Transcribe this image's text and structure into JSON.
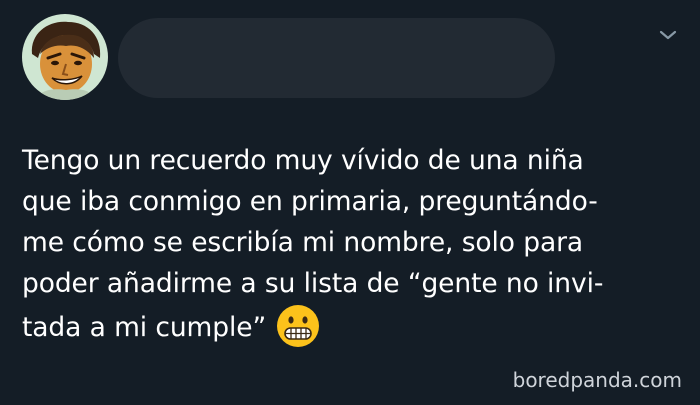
{
  "tweet": {
    "lines": [
      "Tengo un recuerdo muy vívido de una niña",
      "que iba conmigo en primaria, preguntándo-",
      "me cómo se escribía mi nombre, solo para",
      "poder añadirme a su lista de “gente no invi-",
      "tada a mi cumple”"
    ],
    "emoji_icon": "grimacing-face-icon"
  },
  "header": {
    "avatar_icon": "cartoon-face-avatar",
    "menu_icon": "chevron-down-icon"
  },
  "watermark": "boredpanda.com",
  "colors": {
    "background": "#141d26",
    "text": "#ffffff",
    "redacted_name": "#222a33",
    "chevron": "#8899a6"
  }
}
